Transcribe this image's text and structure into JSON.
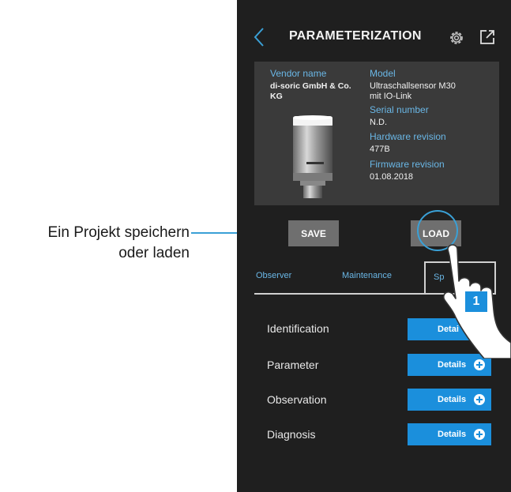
{
  "annotation": {
    "line1": "Ein Projekt speichern",
    "line2": "oder laden"
  },
  "header": {
    "title": "PARAMETERIZATION",
    "back_icon": "chevron-left-icon",
    "settings_icon": "gear-icon",
    "export_icon": "external-link-icon"
  },
  "device": {
    "vendor_label": "Vendor name",
    "vendor_value_1": "di-soric GmbH & Co.",
    "vendor_value_2": "KG",
    "model_label": "Model",
    "model_value_1": "Ultraschallsensor M30",
    "model_value_2": "mit IO-Link",
    "serial_label": "Serial number",
    "serial_value": "N.D.",
    "hw_label": "Hardware revision",
    "hw_value": "477B",
    "fw_label": "Firmware revision",
    "fw_value": "01.08.2018"
  },
  "actions": {
    "save": "SAVE",
    "load": "LOAD"
  },
  "tabs": {
    "observer": "Observer",
    "maintenance": "Maintenance",
    "specialist": "Sp"
  },
  "sections": [
    {
      "label": "Identification",
      "button": "Detai"
    },
    {
      "label": "Parameter",
      "button": "Details"
    },
    {
      "label": "Observation",
      "button": "Details"
    },
    {
      "label": "Diagnosis",
      "button": "Details"
    }
  ],
  "callout": {
    "step": "1"
  },
  "colors": {
    "accent": "#1b8fdc",
    "label_blue": "#6ab7e6",
    "background": "#1f1f1f",
    "card": "#3a3a3a"
  }
}
